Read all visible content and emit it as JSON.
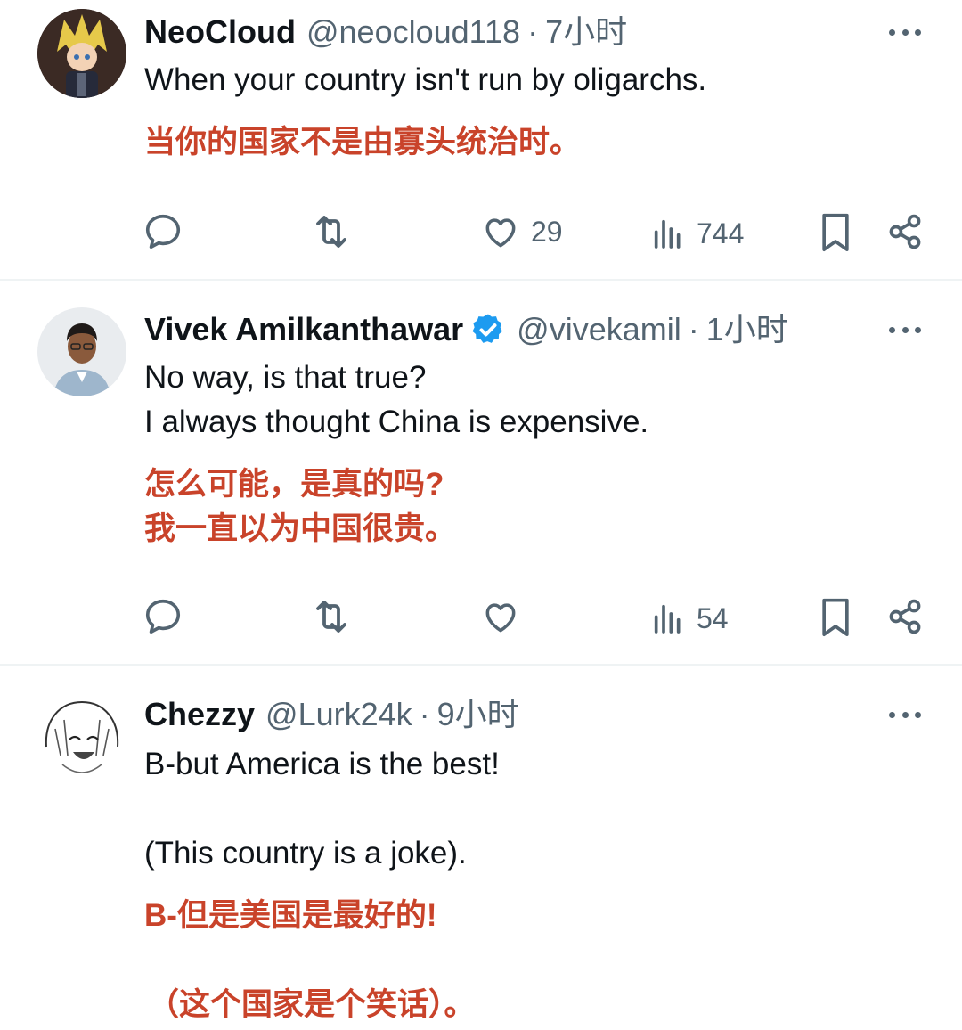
{
  "tweets": [
    {
      "name": "NeoCloud",
      "handle": "@neocloud118",
      "separator": "·",
      "time": "7小时",
      "verified": false,
      "text": [
        "When your country isn't run by oligarchs."
      ],
      "translation": [
        "当你的国家不是由寡头统治时。"
      ],
      "likes": "29",
      "views": "744",
      "avatar_icon": "anime-character-avatar"
    },
    {
      "name": "Vivek Amilkanthawar",
      "handle": "@vivekamil",
      "separator": "·",
      "time": "1小时",
      "verified": true,
      "text": [
        "No way, is that true?",
        "I always thought China is expensive."
      ],
      "translation": [
        "怎么可能，是真的吗?",
        "我一直以为中国很贵。"
      ],
      "likes": "",
      "views": "54",
      "avatar_icon": "person-photo-avatar"
    },
    {
      "name": "Chezzy",
      "handle": "@Lurk24k",
      "separator": "·",
      "time": "9小时",
      "verified": false,
      "text": [
        "B-but America is the best!",
        "(This country is a joke)."
      ],
      "translation": [
        "B-但是美国是最好的!",
        "（这个国家是个笑话）。"
      ],
      "avatar_icon": "manga-sketch-avatar"
    }
  ],
  "colors": {
    "text": "#0f1419",
    "secondary": "#536471",
    "translation": "#c9432a",
    "verified": "#1d9bf0",
    "divider": "#eff3f4"
  },
  "icons": [
    "reply-icon",
    "retweet-icon",
    "like-icon",
    "views-icon",
    "bookmark-icon",
    "share-icon",
    "more-icon"
  ]
}
